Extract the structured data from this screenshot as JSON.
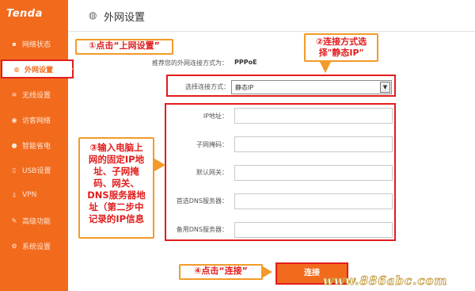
{
  "brand": {
    "logo_text": "Tenda"
  },
  "header": {
    "title": "外网设置"
  },
  "sidebar": {
    "items": [
      {
        "label": "网络状态",
        "icon": "status-icon"
      },
      {
        "label": "外网设置",
        "icon": "globe-icon",
        "active": true
      },
      {
        "label": "无线设置",
        "icon": "wifi-icon"
      },
      {
        "label": "访客网络",
        "icon": "guest-icon"
      },
      {
        "label": "智能省电",
        "icon": "power-icon"
      },
      {
        "label": "USB设置",
        "icon": "usb-icon"
      },
      {
        "label": "VPN",
        "icon": "vpn-icon"
      },
      {
        "label": "高级功能",
        "icon": "tools-icon"
      },
      {
        "label": "系统设置",
        "icon": "settings-icon"
      }
    ]
  },
  "form": {
    "recommend_label": "推荐您的外网连接方式为：",
    "recommend_value": "PPPoE",
    "conn_type_label": "选择连接方式：",
    "conn_type_value": "静态IP",
    "ip_label": "IP地址：",
    "ip_value": "",
    "mask_label": "子网掩码：",
    "mask_value": "",
    "gateway_label": "默认网关：",
    "gateway_value": "",
    "dns1_label": "首选DNS服务器：",
    "dns1_value": "",
    "dns2_label": "备用DNS服务器：",
    "dns2_value": "",
    "connect_label": "连接"
  },
  "annotations": {
    "step1": "①点击“上网设置”",
    "step2_line1": "②连接方式选",
    "step2_line2": "择\"静态IP\"",
    "step3_lines": [
      "③输入电脑上",
      "网的固定IP地",
      "址、子网掩",
      "码、网关、",
      "DNS服务器地",
      "址（第二步中",
      "记录的IP信息"
    ],
    "step4": "④点击“连接”"
  },
  "watermark": "www.886abc.com",
  "colors": {
    "accent": "#f26b1d",
    "highlight": "#e21d1d",
    "callout_border": "#f39a2a"
  }
}
